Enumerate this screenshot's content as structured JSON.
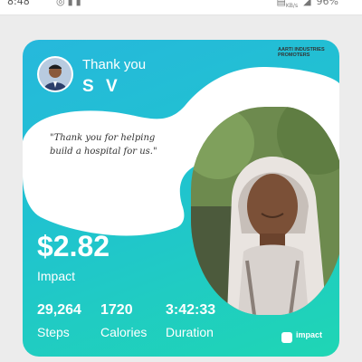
{
  "status_bar": {
    "time": "8:48",
    "left_icons": [
      "whatsapp-icon",
      "signal-icon"
    ],
    "net_speed": "KB/s",
    "battery": "96%"
  },
  "card": {
    "thank_label": "Thank you",
    "donor_name": "S V",
    "org_name": "AARTI INDUSTRIES PROMOTERS",
    "quote": "\"Thank you for helping build a hospital for us.\"",
    "impact_value": "$2.82",
    "impact_label": "Impact",
    "stats": [
      {
        "value": "29,264",
        "label": "Steps"
      },
      {
        "value": "1720",
        "label": "Calories"
      },
      {
        "value": "3:42:33",
        "label": "Duration"
      }
    ],
    "logo_text": "impact"
  },
  "colors": {
    "gradient_start": "#26b8dc",
    "gradient_end": "#1fd6b4",
    "background": "#ececec"
  }
}
